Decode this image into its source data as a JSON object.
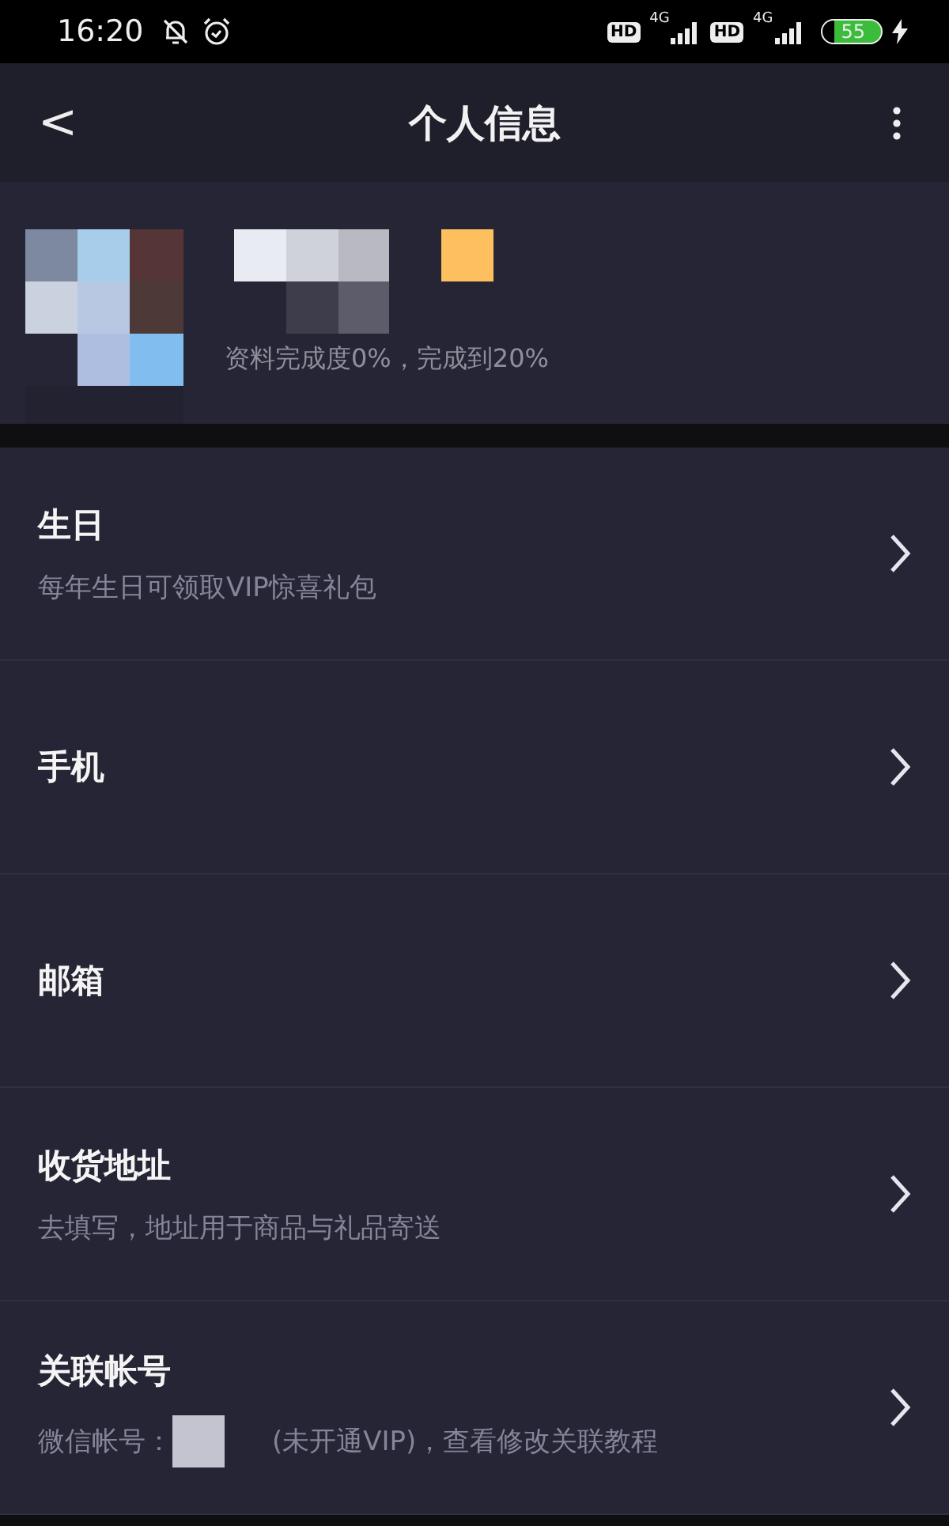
{
  "status_bar": {
    "time": "16:20",
    "networks": [
      {
        "badge": "HD",
        "type": "4G"
      },
      {
        "badge": "HD",
        "type": "4G"
      }
    ],
    "battery": "55"
  },
  "header": {
    "back": "<",
    "title": "个人信息"
  },
  "profile": {
    "completion": "资料完成度0%，完成到20%"
  },
  "items": [
    {
      "kind": "plain",
      "title": "生日",
      "subtitle": "每年生日可领取VIP惊喜礼包"
    },
    {
      "kind": "plain",
      "title": "手机"
    },
    {
      "kind": "plain",
      "title": "邮箱"
    },
    {
      "kind": "plain",
      "title": "收货地址",
      "subtitle": "去填写，地址用于商品与礼品寄送"
    },
    {
      "kind": "account",
      "title": "关联帐号",
      "prefix": "微信帐号：",
      "suffix": "(未开通VIP)，查看修改关联教程"
    }
  ]
}
